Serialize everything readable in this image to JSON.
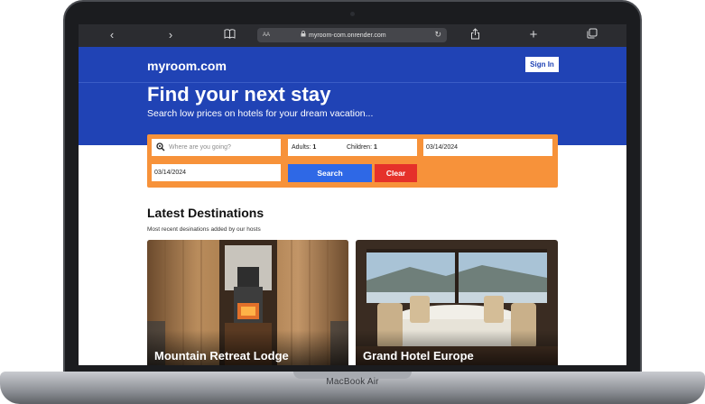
{
  "device": {
    "label": "MacBook Air"
  },
  "browser": {
    "url": "myroom-com.onrender.com",
    "reader_label": "AA",
    "icons": [
      "back-icon",
      "forward-icon",
      "book-icon",
      "lock-icon",
      "reload-icon",
      "share-icon",
      "plus-icon",
      "tabs-icon"
    ]
  },
  "header": {
    "brand": "myroom.com",
    "signin_label": "Sign In",
    "title": "Find your next stay",
    "subtitle": "Search low prices on hotels for your dream vacation..."
  },
  "search": {
    "destination_placeholder": "Where are you going?",
    "adults_label": "Adults:",
    "adults_value": "1",
    "children_label": "Children:",
    "children_value": "1",
    "checkin": "03/14/2024",
    "checkout": "03/14/2024",
    "search_label": "Search",
    "clear_label": "Clear"
  },
  "destinations": {
    "title": "Latest Destinations",
    "subtitle": "Most recent desinations added by our hosts",
    "cards": [
      {
        "name": "Mountain Retreat Lodge"
      },
      {
        "name": "Grand Hotel Europe"
      }
    ]
  },
  "colors": {
    "brand_blue": "#2043b5",
    "panel_orange": "#f7923a",
    "search_blue": "#2e68e6",
    "clear_red": "#e5312a"
  }
}
